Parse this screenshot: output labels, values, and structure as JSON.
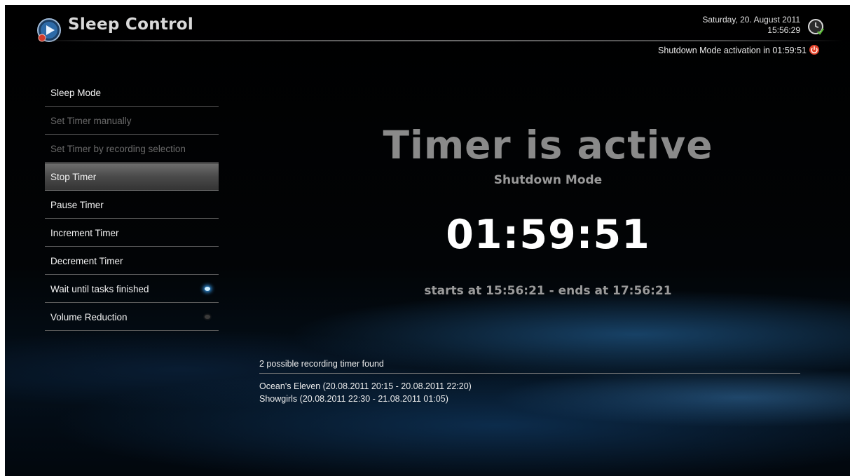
{
  "header": {
    "app_title": "Sleep Control",
    "app_icon": "sleep-control-logo",
    "date": "Saturday, 20. August 2011",
    "time": "15:56:29",
    "clock_icon": "clock-icon",
    "shutdown_info": "Shutdown Mode activation in 01:59:51",
    "power_icon": "power-icon",
    "power_icon_color": "#e2432b"
  },
  "menu": {
    "items": [
      {
        "label": "Sleep Mode",
        "state": "enabled"
      },
      {
        "label": "Set Timer manually",
        "state": "disabled"
      },
      {
        "label": "Set Timer by recording selection",
        "state": "disabled"
      },
      {
        "label": "Stop Timer",
        "state": "selected"
      },
      {
        "label": "Pause Timer",
        "state": "enabled"
      },
      {
        "label": "Increment Timer",
        "state": "enabled"
      },
      {
        "label": "Decrement Timer",
        "state": "enabled"
      },
      {
        "label": "Wait until tasks finished",
        "state": "enabled",
        "toggle": "on"
      },
      {
        "label": "Volume Reduction",
        "state": "enabled",
        "toggle": "off"
      }
    ]
  },
  "status": {
    "title": "Timer is active",
    "mode": "Shutdown Mode",
    "countdown": "01:59:51",
    "time_range": "starts at 15:56:21 - ends at 17:56:21"
  },
  "recordings": {
    "header": "2 possible recording timer found",
    "items": [
      "Ocean's Eleven (20.08.2011 20:15 - 20.08.2011 22:20)",
      "Showgirls (20.08.2011 22:30 - 21.08.2011 01:05)"
    ]
  },
  "colors": {
    "accent": "#3aa7ff",
    "background": "#000000",
    "disabled_text": "#6a6a6a"
  }
}
